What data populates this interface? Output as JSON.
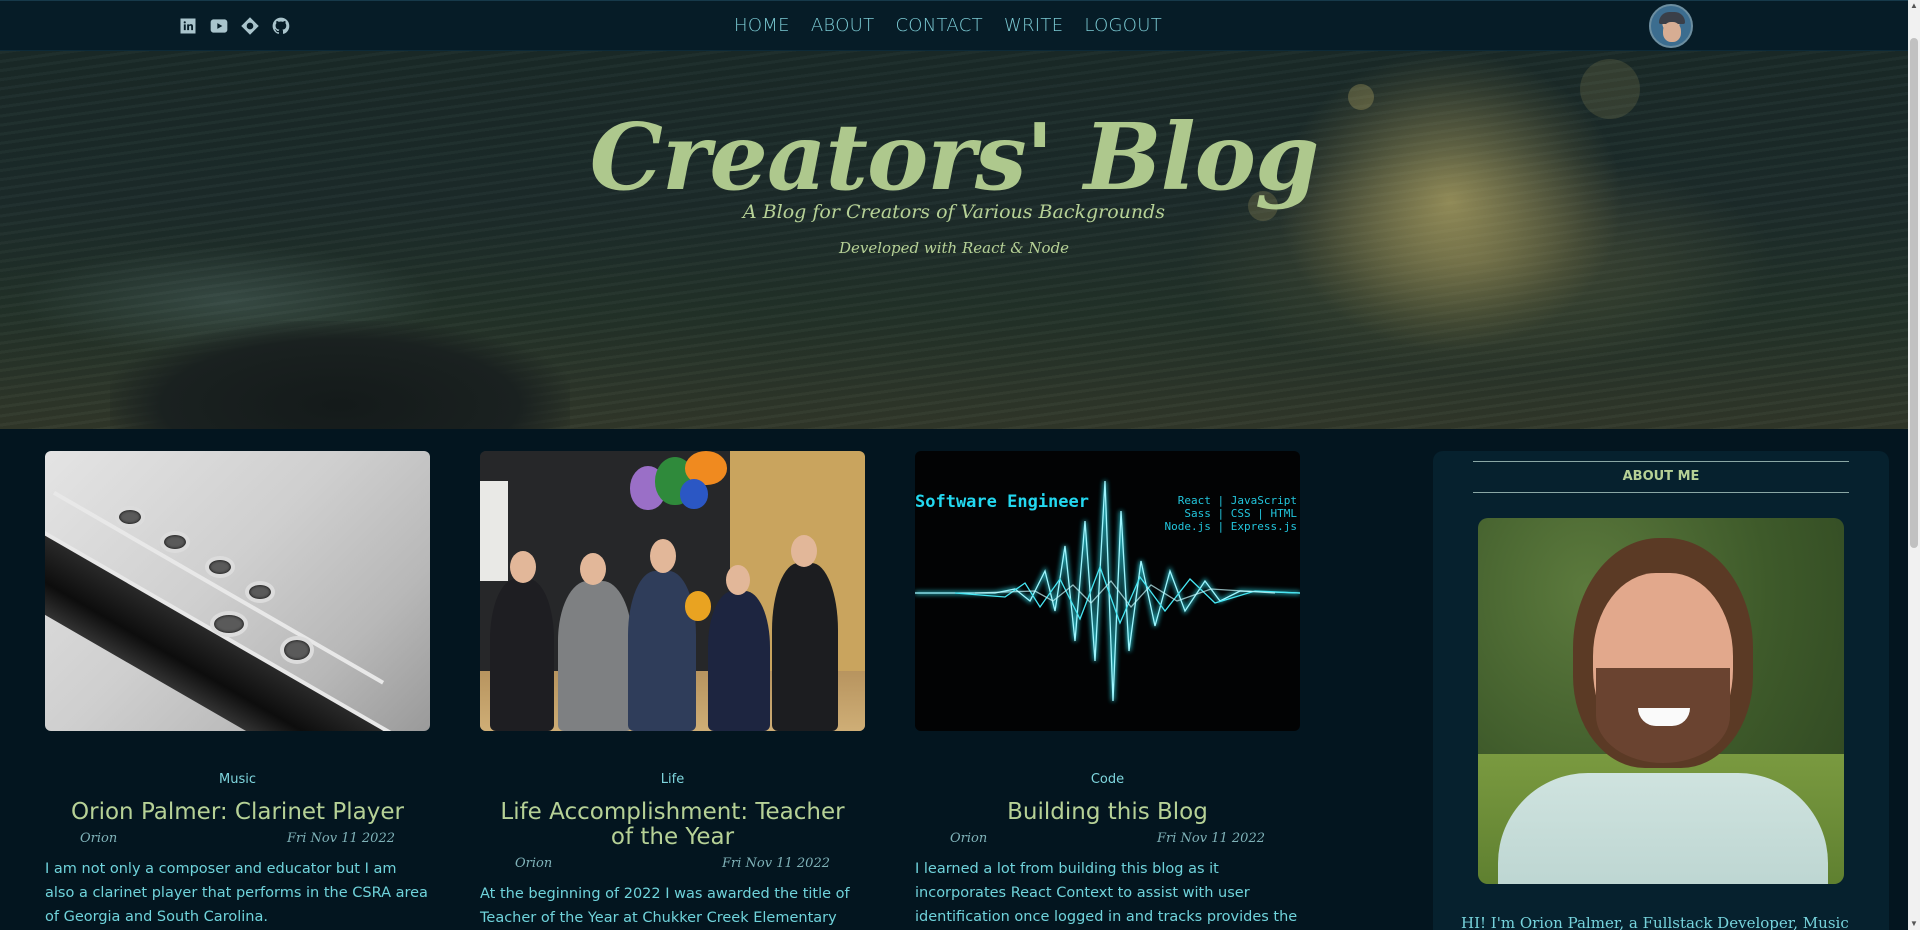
{
  "topbar": {
    "social_icons": [
      "linkedin-icon",
      "youtube-icon",
      "diamond-icon",
      "github-icon"
    ],
    "nav": [
      {
        "label": "HOME"
      },
      {
        "label": "ABOUT"
      },
      {
        "label": "CONTACT"
      },
      {
        "label": "WRITE"
      },
      {
        "label": "LOGOUT"
      }
    ]
  },
  "hero": {
    "title": "Creators' Blog",
    "subtitle": "A Blog for Creators of Various Backgrounds",
    "developed": "Developed with React & Node"
  },
  "posts": [
    {
      "category": "Music",
      "title": "Orion Palmer: Clarinet Player",
      "author": "Orion",
      "date": "Fri Nov 11 2022",
      "excerpt": "I am not only a composer and educator but I am also a clarinet player that performs in the CSRA area of Georgia and South Carolina."
    },
    {
      "category": "Life",
      "title": "Life Accomplishment: Teacher of the Year",
      "author": "Orion",
      "date": "Fri Nov 11 2022",
      "excerpt": "At the beginning of 2022 I was awarded the title of Teacher of the Year at Chukker Creek Elementary School."
    },
    {
      "category": "Code",
      "title": "Building this Blog",
      "author": "Orion",
      "date": "Fri Nov 11 2022",
      "excerpt": "I learned a lot from building this blog as it incorporates React Context to assist with user identification once logged in and tracks provides the user info need in order",
      "image_text": {
        "label": "Software Engineer",
        "stack": [
          "React | JavaScript",
          "Sass | CSS | HTML",
          "Node.js | Express.js"
        ]
      }
    }
  ],
  "sidebar": {
    "heading": "ABOUT ME",
    "bio": "HI! I'm Orion Palmer, a Fullstack Developer, Music"
  },
  "colors": {
    "background": "#03151f",
    "topbar": "#061c27",
    "accent_green": "#b6d196",
    "accent_cyan": "#79d6df"
  }
}
